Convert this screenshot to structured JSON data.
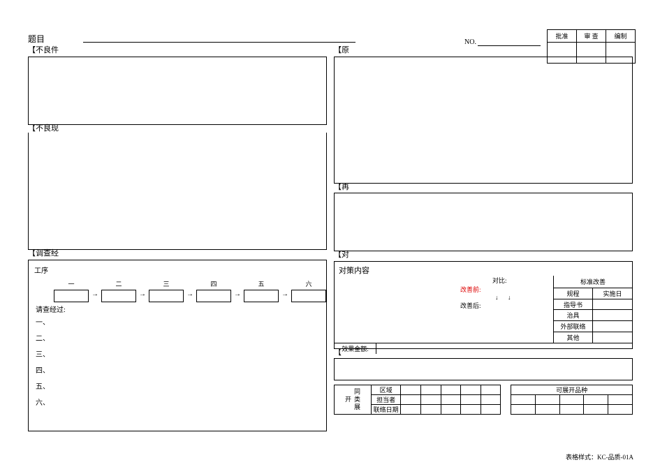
{
  "header": {
    "title_label": "题目",
    "no_label": "NO.",
    "approval": [
      "批准",
      "审 查",
      "编制"
    ]
  },
  "left": {
    "sec1_label": "【不良件",
    "sec2_label": "【不良现",
    "sec3_label": "【调查经",
    "flow_label": "工序",
    "flow_steps": [
      "一",
      "二",
      "三",
      "四",
      "五",
      "六"
    ],
    "check_label": "请查经过:",
    "check_items": [
      "一、",
      "二、",
      "三、",
      "四、",
      "五、",
      "六、"
    ]
  },
  "right": {
    "sec1_label": "【原",
    "sec2_label": "【再",
    "sec3_label": "【对",
    "sec4_label": "【",
    "cm_title": "对策内容",
    "cm_compare_label": "对比:",
    "cm_before": "改善前:",
    "cm_after": "改善后:",
    "std_change": "标准改善",
    "std_rows": {
      "r1": [
        "规程",
        "实施日"
      ],
      "r2": "指导书",
      "r3": "治具",
      "r4": "外部联络",
      "r5": "其他"
    },
    "effect_label": "效果金额:"
  },
  "bottom": {
    "expand_vhead": "同类展开",
    "expand_rows": [
      "区域",
      "担当者",
      "联络日期"
    ],
    "variety_title": "可展开品种"
  },
  "footer": "表格样式：KC-品质-01A"
}
